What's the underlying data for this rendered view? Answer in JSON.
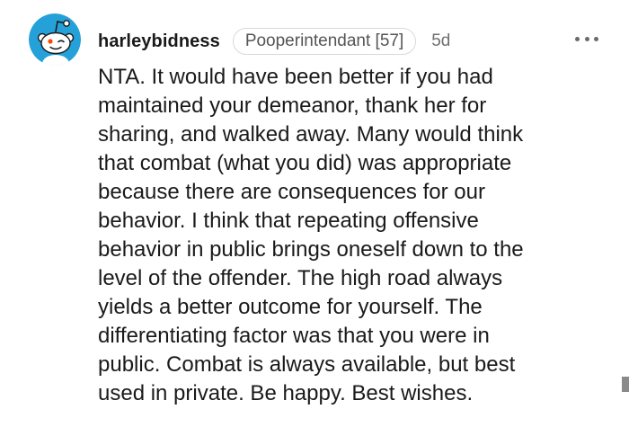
{
  "comment": {
    "avatar": {
      "icon": "snoo-avatar-icon",
      "bg_color": "#25a1d9"
    },
    "username": "harleybidness",
    "flair": "Pooperintendant [57]",
    "timestamp": "5d",
    "more_options": {
      "icon": "more-options-icon"
    },
    "body_lines": [
      "NTA. It would have been better if you had",
      "maintained your demeanor, thank her for",
      "sharing, and walked away. Many would think",
      "that combat (what you did) was appropriate",
      "because there are consequences for our",
      "behavior. I think that repeating offensive",
      "behavior in public brings oneself down to the",
      "level of the offender. The high road always",
      "yields a better outcome for yourself. The",
      "differentiating factor was that you were in",
      "public. Combat is always available, but best",
      "used in private. Be happy. Best wishes."
    ]
  }
}
